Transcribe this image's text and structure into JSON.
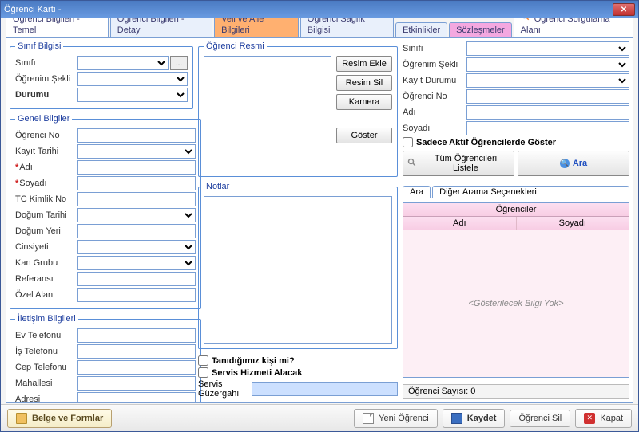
{
  "window": {
    "title": "Öğrenci Kartı -"
  },
  "tabs": {
    "t1": "Öğrenci Bilgileri - Temel",
    "t2": "Öğrenci Bilgileri - Detay",
    "t3": "Veli ve Aile Bilgileri",
    "t4": "Öğrenci Sağlık Bilgisi",
    "t5": "Etkinlikler",
    "t6": "Sözleşmeler",
    "query": "Öğrenci Sorgulama Alanı"
  },
  "class_info": {
    "legend": "Sınıf Bilgisi",
    "class_label": "Sınıfı",
    "edu_label": "Öğrenim Şekli",
    "status_label": "Durumu",
    "btn": "..."
  },
  "general": {
    "legend": "Genel Bilgiler",
    "no_label": "Öğrenci No",
    "reg_label": "Kayıt Tarihi",
    "name_label": "Adı",
    "surname_label": "Soyadı",
    "tc_label": "TC Kimlik No",
    "birth_label": "Doğum Tarihi",
    "bplace_label": "Doğum Yeri",
    "gender_label": "Cinsiyeti",
    "blood_label": "Kan Grubu",
    "ref_label": "Referansı",
    "custom_label": "Özel Alan"
  },
  "contact": {
    "legend": "İletişim Bilgileri",
    "home_label": "Ev Telefonu",
    "work_label": "İş Telefonu",
    "mobile_label": "Cep Telefonu",
    "district_label": "Mahallesi",
    "address_label": "Adresi"
  },
  "photo": {
    "legend": "Öğrenci Resmi",
    "add": "Resim Ekle",
    "del": "Resim Sil",
    "cam": "Kamera",
    "show": "Göster"
  },
  "notes": {
    "legend": "Notlar",
    "value": ""
  },
  "known": {
    "known_label": "Tanıdığımız kişi mi?",
    "service_label": "Servis Hizmeti Alacak"
  },
  "service_route": {
    "label": "Servis Güzergahı",
    "value": ""
  },
  "query": {
    "class_label": "Sınıfı",
    "edu_label": "Öğrenim Şekli",
    "reg_label": "Kayıt Durumu",
    "no_label": "Öğrenci No",
    "name_label": "Adı",
    "surname_label": "Soyadı",
    "active_only": "Sadece Aktif Öğrencilerde Göster",
    "list_all": "Tüm Öğrencileri Listele",
    "search": "Ara",
    "sub_tab_search": "Ara",
    "sub_tab_other": "Diğer Arama Seçenekleri",
    "grid_title": "Öğrenciler",
    "col_name": "Adı",
    "col_surname": "Soyadı",
    "empty": "<Gösterilecek Bilgi Yok>",
    "count": "Öğrenci Sayısı: 0"
  },
  "footer": {
    "docs": "Belge ve Formlar",
    "new": "Yeni Öğrenci",
    "save": "Kaydet",
    "delete": "Öğrenci Sil",
    "close": "Kapat"
  }
}
